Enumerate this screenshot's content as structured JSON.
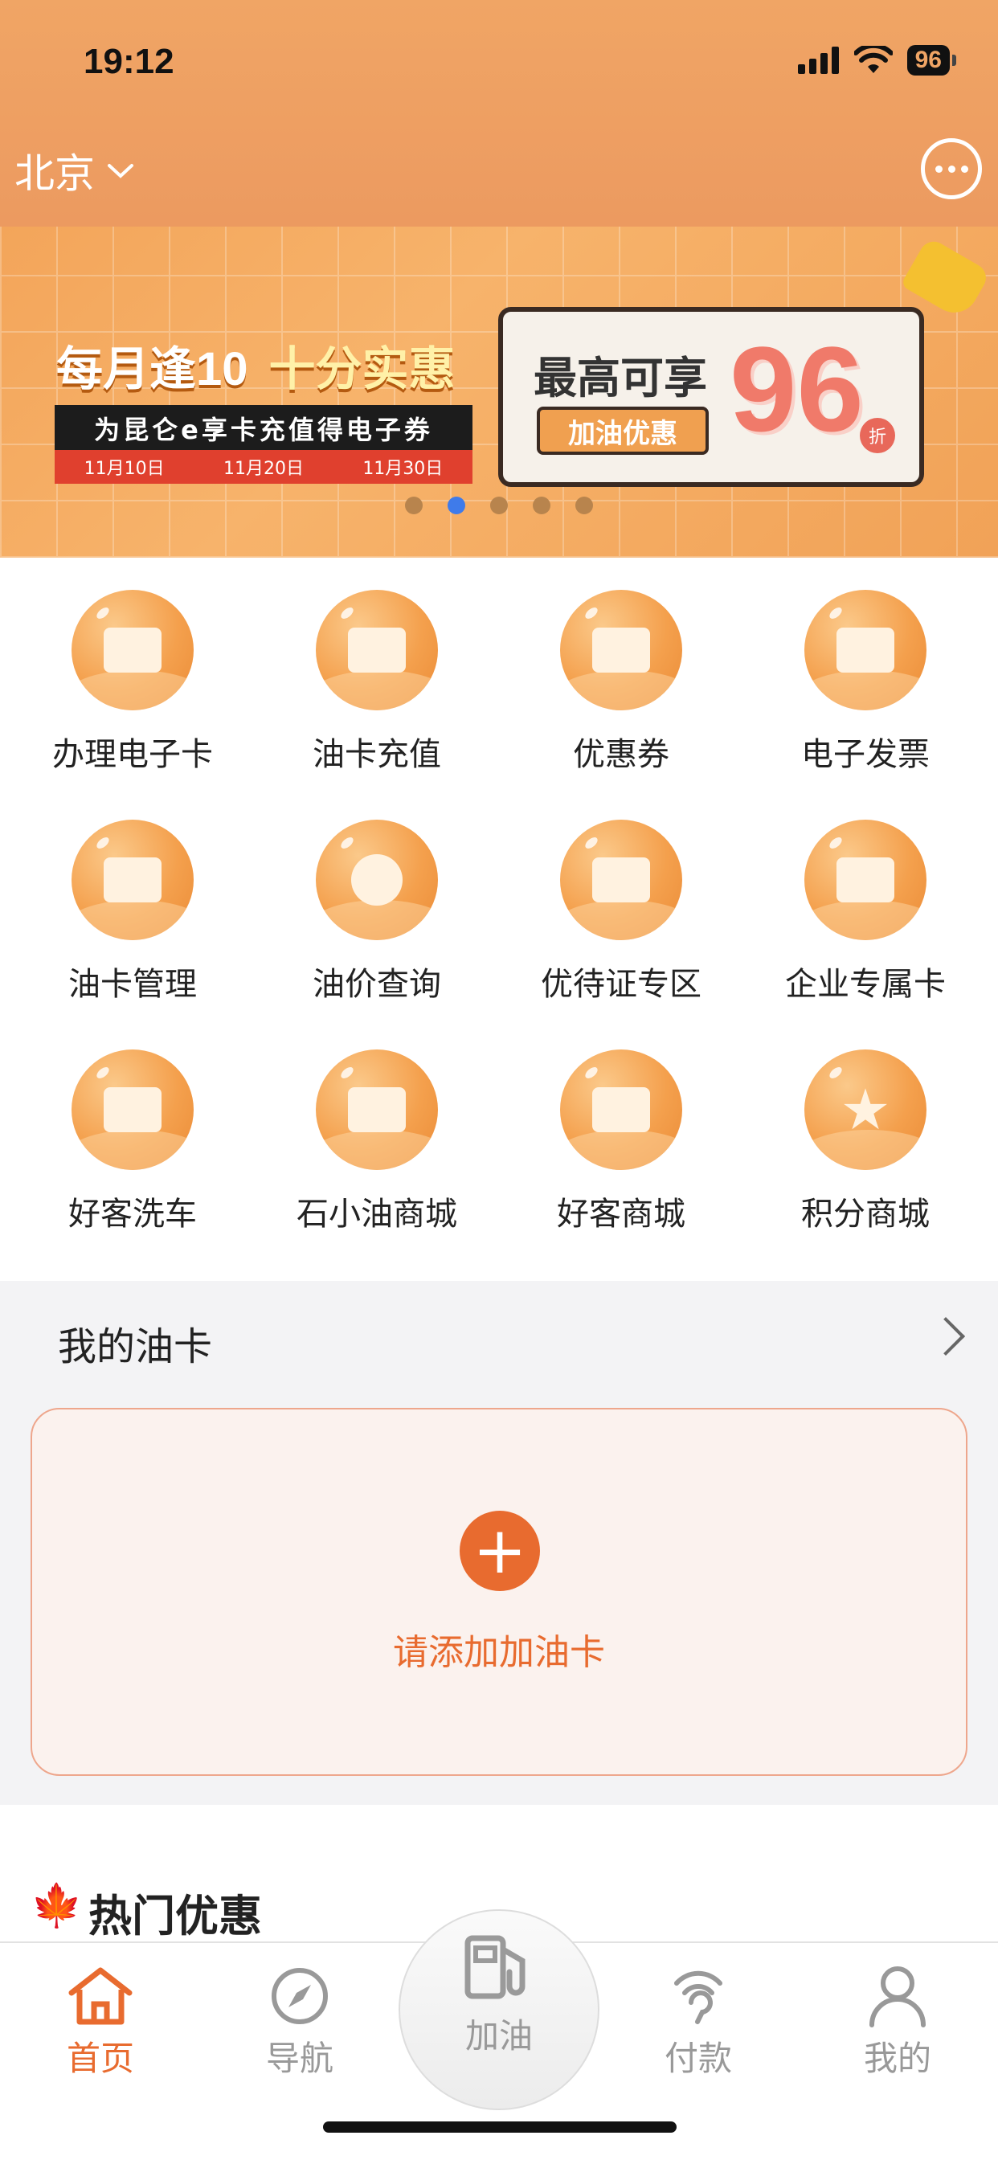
{
  "status_bar": {
    "time": "19:12",
    "battery": "96"
  },
  "header": {
    "city": "北京"
  },
  "banner": {
    "title_left": "每月逢10",
    "title_right": "十分实惠",
    "subtitle": "为昆仑e享卡充值得电子券",
    "dates": [
      "11月10日",
      "11月20日",
      "11月30日"
    ],
    "card_headline": "最高可享",
    "card_button": "加油优惠",
    "card_big_number": "96",
    "card_unit": "折",
    "page_count": 5,
    "active_page": 2
  },
  "services": [
    {
      "label": "办理电子卡",
      "icon": "card-icon"
    },
    {
      "label": "油卡充值",
      "icon": "recharge-icon"
    },
    {
      "label": "优惠券",
      "icon": "coupon-icon"
    },
    {
      "label": "电子发票",
      "icon": "invoice-icon"
    },
    {
      "label": "油卡管理",
      "icon": "card-manage-icon"
    },
    {
      "label": "油价查询",
      "icon": "oil-price-icon"
    },
    {
      "label": "优待证专区",
      "icon": "certificate-icon"
    },
    {
      "label": "企业专属卡",
      "icon": "enterprise-card-icon"
    },
    {
      "label": "好客洗车",
      "icon": "car-wash-icon"
    },
    {
      "label": "石小油商城",
      "icon": "store-icon"
    },
    {
      "label": "好客商城",
      "icon": "shopping-bag-icon"
    },
    {
      "label": "积分商城",
      "icon": "star-icon"
    }
  ],
  "my_card": {
    "title": "我的油卡",
    "add_label": "请添加加油卡"
  },
  "hot_deals": {
    "title": "热门优惠"
  },
  "tabbar": {
    "items": [
      {
        "label": "首页",
        "icon": "home-icon",
        "active": true
      },
      {
        "label": "导航",
        "icon": "compass-icon",
        "active": false
      },
      {
        "label": "加油",
        "icon": "fuel-pump-icon",
        "active": false
      },
      {
        "label": "付款",
        "icon": "contactless-pay-icon",
        "active": false
      },
      {
        "label": "我的",
        "icon": "user-icon",
        "active": false
      }
    ]
  },
  "colors": {
    "accent": "#e86b2f",
    "header": "#ec9a60",
    "inactive": "#999999"
  }
}
